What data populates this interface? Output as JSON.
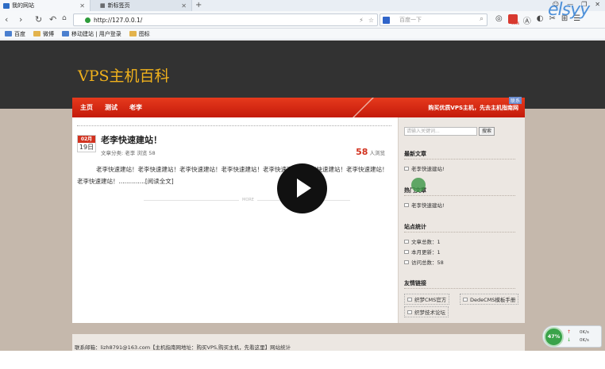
{
  "browser": {
    "tabs": [
      {
        "label": "我的网站"
      },
      {
        "label": "新标签页"
      }
    ],
    "new_tab": "+",
    "url": "http://127.0.0.1/",
    "search_placeholder": "百度一下",
    "notification_badge": "3866",
    "bookmarks": [
      {
        "label": "百度",
        "icon": "baidu-icon"
      },
      {
        "label": "微博",
        "icon": "folder-icon"
      },
      {
        "label": "移动建站 | 用户登录",
        "icon": "site-icon"
      },
      {
        "label": "图标",
        "icon": "folder-icon"
      }
    ],
    "watermark": "elsyy"
  },
  "site": {
    "title": "VPS主机百科",
    "nav": [
      {
        "label": "主页"
      },
      {
        "label": "测试"
      },
      {
        "label": "老李"
      }
    ],
    "slogan": "购买优质VPS主机，先去主机指南网",
    "nav_tag": "联系"
  },
  "post": {
    "month": "02月",
    "day": "19日",
    "title": "老李快速建站！",
    "meta": "文章分类: 老李  浏览 58",
    "views_num": "58",
    "views_label": "人浏览",
    "excerpt": "老李快速建站！老李快速建站！老李快速建站！老李快速建站！老李快速建站！老李快速建站！老李快速建站！老李快速建站！..............[阅读全文]",
    "separator": "MORE"
  },
  "sidebar": {
    "search_placeholder": "请输入关键词...",
    "search_button": "搜索",
    "latest_heading": "最新文章",
    "latest_items": [
      "老李快速建站!"
    ],
    "hot_heading": "热门文章",
    "hot_items": [
      "老李快速建站!"
    ],
    "stats_heading": "站点统计",
    "stats_items": [
      "文章总数：1",
      "本月更新：1",
      "访问总数：58"
    ],
    "links_heading": "友情链接",
    "links": [
      "织梦CMS官方",
      "DedeCMS模板手册",
      "织梦技术论坛"
    ]
  },
  "footer": {
    "text": "联系邮箱：lizh8791@163.com【主机指南网地址：购买VPS,购买主机，先看这里】网站统计"
  },
  "net_widget": {
    "percent": "47%",
    "up": "0K/s",
    "down": "0K/s"
  },
  "colors": {
    "header_bg": "#323232",
    "site_title": "#f0b11c",
    "nav_red": "#d42a15",
    "page_bg": "#c5b8ac"
  }
}
